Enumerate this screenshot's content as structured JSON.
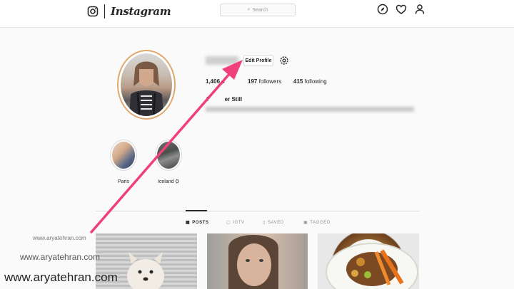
{
  "nav": {
    "brand": "Instagram",
    "search_placeholder": "Search",
    "icons": [
      "instagram-glyph-icon",
      "compass-icon",
      "heart-icon",
      "user-icon"
    ]
  },
  "profile": {
    "edit_profile_label": "Edit Profile",
    "posts_count": "1,406",
    "posts_label": "p",
    "followers_count": "197",
    "followers_label": "followers",
    "following_count": "415",
    "following_label": "following",
    "full_name": "J          er Still"
  },
  "highlights": [
    {
      "label": "Paris"
    },
    {
      "label": "Iceland ⛭"
    }
  ],
  "tabs": [
    {
      "label": "POSTS",
      "active": true
    },
    {
      "label": "IGTV",
      "active": false
    },
    {
      "label": "SAVED",
      "active": false
    },
    {
      "label": "TAGGED",
      "active": false
    }
  ],
  "watermarks": {
    "small": "www.aryatehran.com",
    "medium": "www.aryatehran.com",
    "large": "www.aryatehran.com"
  },
  "colors": {
    "annotation_arrow": "#f0407a",
    "avatar_ring": "#e0a86a"
  }
}
